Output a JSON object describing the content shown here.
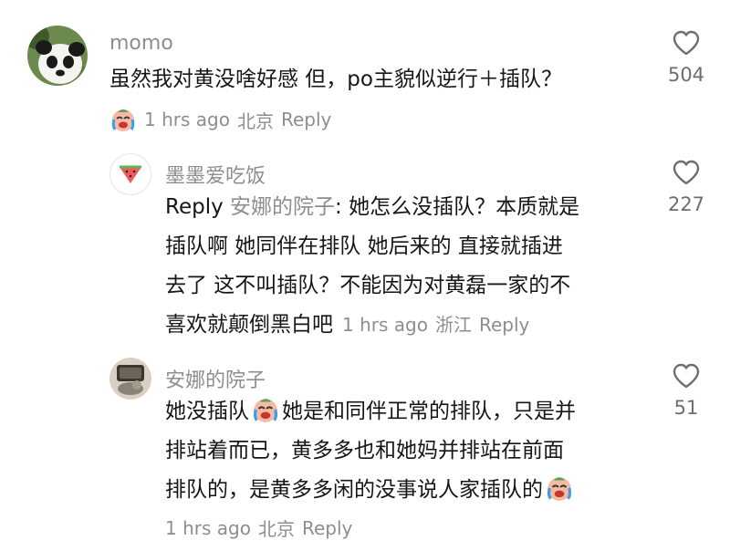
{
  "comments": [
    {
      "username": "momo",
      "avatar_icon": "panda-avatar-icon",
      "text": "虽然我对黄没啥好感 但，po主貌似逆行＋插队？",
      "meta_time": "1 hrs ago",
      "meta_location": "北京",
      "reply_label": "Reply",
      "like_count": "504",
      "meta_emoji": "crying-laughing-face-icon"
    },
    {
      "username": "墨墨爱吃饭",
      "avatar_icon": "watermelon-avatar-icon",
      "reply_prefix": "Reply",
      "mention": "安娜的院子",
      "text_lines": [
        ": 她怎么没插队？本质就是",
        "插队啊 她同伴在排队 她后来的 直接就插进",
        "去了 这不叫插队？不能因为对黄磊一家的不",
        "喜欢就颠倒黑白吧"
      ],
      "meta_time": "1 hrs ago",
      "meta_location": "浙江",
      "reply_label": "Reply",
      "like_count": "227"
    },
    {
      "username": "安娜的院子",
      "avatar_icon": "cat-photo-avatar-icon",
      "text_line1_a": "她没插队",
      "text_line1_b": "她是和同伴正常的排队，只是并",
      "text_line2": "排站着而已，黄多多也和她妈并排站在前面",
      "text_line3": "排队的，是黄多多闲的没事说人家插队的",
      "meta_time": "1 hrs ago",
      "meta_location": "北京",
      "reply_label": "Reply",
      "like_count": "51",
      "inline_emoji": "crying-laughing-face-icon"
    }
  ],
  "colors": {
    "text": "#161616",
    "secondary": "#8e8e8e",
    "background": "#ffffff"
  }
}
